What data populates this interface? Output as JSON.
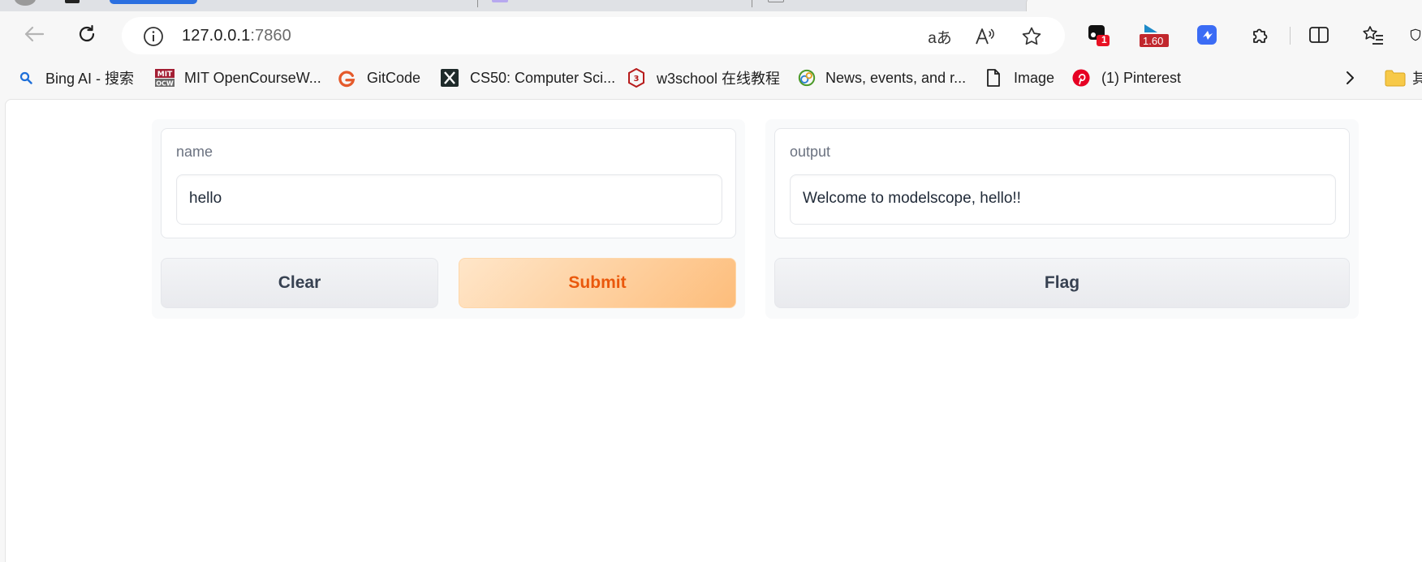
{
  "browser": {
    "address": {
      "host": "127.0.0.1",
      "port": ":7860"
    },
    "extension_badges": {
      "ext1_badge": "1",
      "ext2_badge": "1.60"
    },
    "bookmarks": [
      {
        "label": "Bing AI - 搜索",
        "icon": "search-icon"
      },
      {
        "label": "MIT OpenCourseW...",
        "icon": "mit-logo-icon"
      },
      {
        "label": "GitCode",
        "icon": "gitcode-icon"
      },
      {
        "label": "CS50: Computer Sci...",
        "icon": "cs50-icon"
      },
      {
        "label": "w3school 在线教程",
        "icon": "w3school-icon"
      },
      {
        "label": "News, events, and r...",
        "icon": "globe-icon"
      },
      {
        "label": "Image",
        "icon": "file-icon"
      },
      {
        "label": "(1) Pinterest",
        "icon": "pinterest-icon"
      }
    ],
    "overflow_folder_label": "其"
  },
  "app": {
    "input_panel": {
      "name_label": "name",
      "name_value": "hello",
      "clear_label": "Clear",
      "submit_label": "Submit"
    },
    "output_panel": {
      "output_label": "output",
      "output_value": "Welcome to modelscope, hello!!",
      "flag_label": "Flag"
    }
  },
  "colors": {
    "accent_orange": "#ea580c",
    "tab_active_blue": "#2b6fe0"
  }
}
